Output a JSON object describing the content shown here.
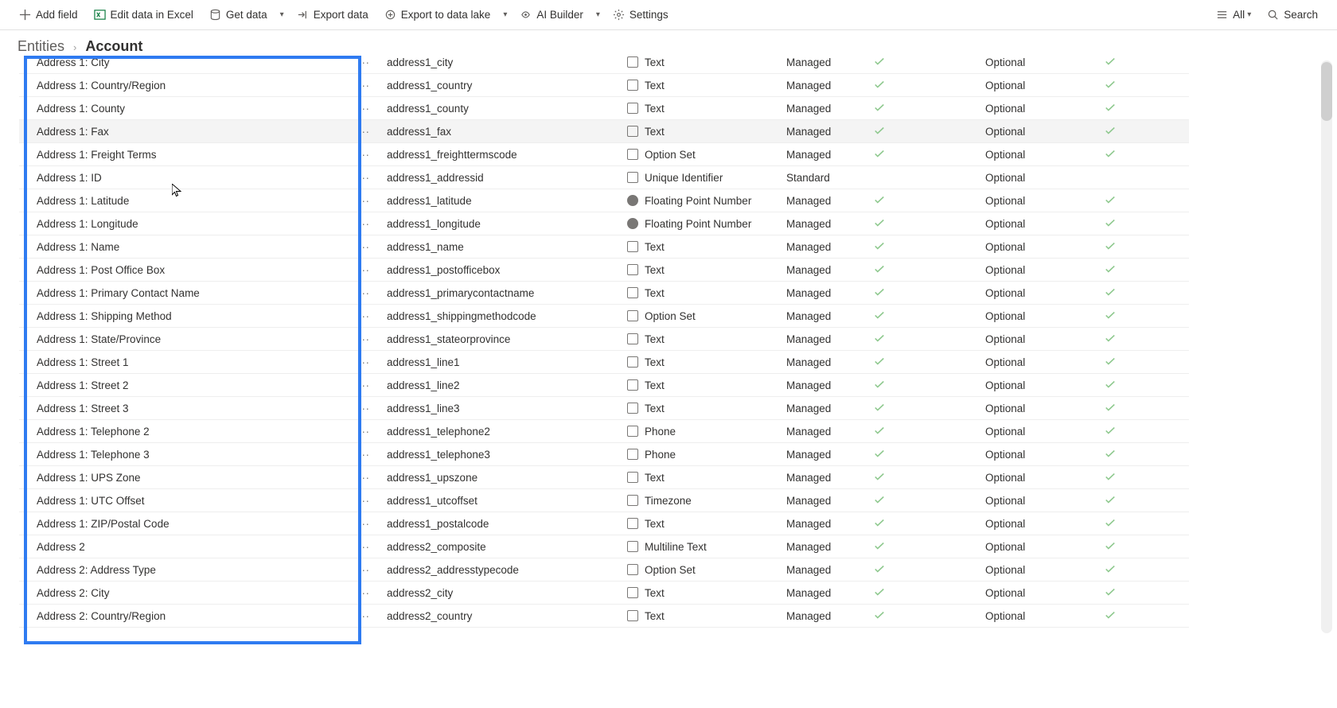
{
  "toolbar": {
    "add_field": "Add field",
    "edit_excel": "Edit data in Excel",
    "get_data": "Get data",
    "export_data": "Export data",
    "export_lake": "Export to data lake",
    "ai_builder": "AI Builder",
    "settings": "Settings",
    "view_all": "All",
    "search_placeholder": "Search"
  },
  "breadcrumb": {
    "root": "Entities",
    "current": "Account"
  },
  "type_labels": {
    "text": "Text",
    "optionset": "Option Set",
    "uid": "Unique Identifier",
    "float": "Floating Point Number",
    "phone": "Phone",
    "timezone": "Timezone",
    "multiline": "Multiline Text"
  },
  "managed_labels": {
    "managed": "Managed",
    "standard": "Standard"
  },
  "required_label": "Optional",
  "rows": [
    {
      "display": "Address 1: City",
      "name": "address1_city",
      "type": "text",
      "managed": "managed",
      "check1": true,
      "required": true,
      "check2": true
    },
    {
      "display": "Address 1: Country/Region",
      "name": "address1_country",
      "type": "text",
      "managed": "managed",
      "check1": true,
      "required": true,
      "check2": true
    },
    {
      "display": "Address 1: County",
      "name": "address1_county",
      "type": "text",
      "managed": "managed",
      "check1": true,
      "required": true,
      "check2": true
    },
    {
      "display": "Address 1: Fax",
      "name": "address1_fax",
      "type": "text",
      "managed": "managed",
      "check1": true,
      "required": true,
      "check2": true,
      "highlighted": true
    },
    {
      "display": "Address 1: Freight Terms",
      "name": "address1_freighttermscode",
      "type": "optionset",
      "managed": "managed",
      "check1": true,
      "required": true,
      "check2": true
    },
    {
      "display": "Address 1: ID",
      "name": "address1_addressid",
      "type": "uid",
      "managed": "standard",
      "check1": false,
      "required": true,
      "check2": false
    },
    {
      "display": "Address 1: Latitude",
      "name": "address1_latitude",
      "type": "float",
      "managed": "managed",
      "check1": true,
      "required": true,
      "check2": true
    },
    {
      "display": "Address 1: Longitude",
      "name": "address1_longitude",
      "type": "float",
      "managed": "managed",
      "check1": true,
      "required": true,
      "check2": true
    },
    {
      "display": "Address 1: Name",
      "name": "address1_name",
      "type": "text",
      "managed": "managed",
      "check1": true,
      "required": true,
      "check2": true
    },
    {
      "display": "Address 1: Post Office Box",
      "name": "address1_postofficebox",
      "type": "text",
      "managed": "managed",
      "check1": true,
      "required": true,
      "check2": true
    },
    {
      "display": "Address 1: Primary Contact Name",
      "name": "address1_primarycontactname",
      "type": "text",
      "managed": "managed",
      "check1": true,
      "required": true,
      "check2": true
    },
    {
      "display": "Address 1: Shipping Method",
      "name": "address1_shippingmethodcode",
      "type": "optionset",
      "managed": "managed",
      "check1": true,
      "required": true,
      "check2": true
    },
    {
      "display": "Address 1: State/Province",
      "name": "address1_stateorprovince",
      "type": "text",
      "managed": "managed",
      "check1": true,
      "required": true,
      "check2": true
    },
    {
      "display": "Address 1: Street 1",
      "name": "address1_line1",
      "type": "text",
      "managed": "managed",
      "check1": true,
      "required": true,
      "check2": true
    },
    {
      "display": "Address 1: Street 2",
      "name": "address1_line2",
      "type": "text",
      "managed": "managed",
      "check1": true,
      "required": true,
      "check2": true
    },
    {
      "display": "Address 1: Street 3",
      "name": "address1_line3",
      "type": "text",
      "managed": "managed",
      "check1": true,
      "required": true,
      "check2": true
    },
    {
      "display": "Address 1: Telephone 2",
      "name": "address1_telephone2",
      "type": "phone",
      "managed": "managed",
      "check1": true,
      "required": true,
      "check2": true
    },
    {
      "display": "Address 1: Telephone 3",
      "name": "address1_telephone3",
      "type": "phone",
      "managed": "managed",
      "check1": true,
      "required": true,
      "check2": true
    },
    {
      "display": "Address 1: UPS Zone",
      "name": "address1_upszone",
      "type": "text",
      "managed": "managed",
      "check1": true,
      "required": true,
      "check2": true
    },
    {
      "display": "Address 1: UTC Offset",
      "name": "address1_utcoffset",
      "type": "timezone",
      "managed": "managed",
      "check1": true,
      "required": true,
      "check2": true
    },
    {
      "display": "Address 1: ZIP/Postal Code",
      "name": "address1_postalcode",
      "type": "text",
      "managed": "managed",
      "check1": true,
      "required": true,
      "check2": true
    },
    {
      "display": "Address 2",
      "name": "address2_composite",
      "type": "multiline",
      "managed": "managed",
      "check1": true,
      "required": true,
      "check2": true
    },
    {
      "display": "Address 2: Address Type",
      "name": "address2_addresstypecode",
      "type": "optionset",
      "managed": "managed",
      "check1": true,
      "required": true,
      "check2": true
    },
    {
      "display": "Address 2: City",
      "name": "address2_city",
      "type": "text",
      "managed": "managed",
      "check1": true,
      "required": true,
      "check2": true
    },
    {
      "display": "Address 2: Country/Region",
      "name": "address2_country",
      "type": "text",
      "managed": "managed",
      "check1": true,
      "required": true,
      "check2": true
    }
  ]
}
